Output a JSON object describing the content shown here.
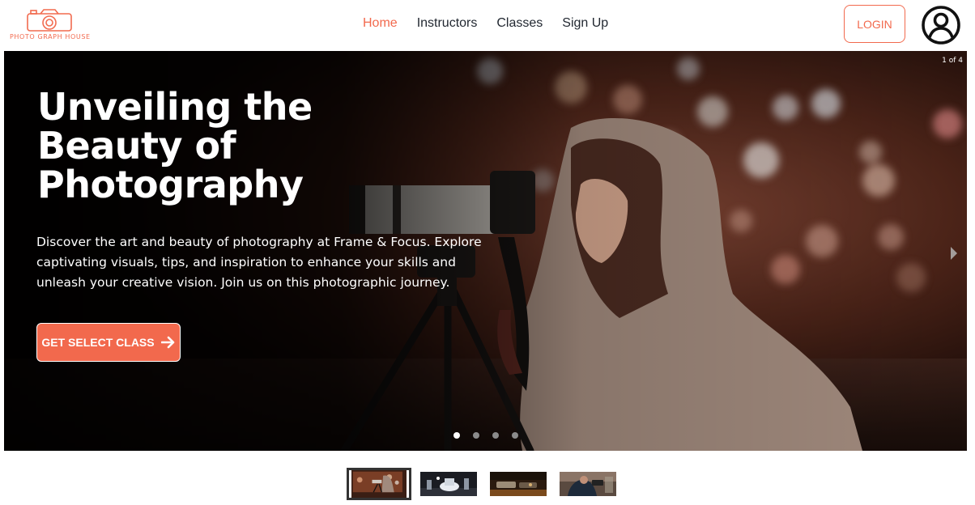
{
  "brand": {
    "name": "PHOTO GRAPH HOUSE",
    "accent": "#f2694d"
  },
  "nav": {
    "links": [
      {
        "label": "Home",
        "active": true
      },
      {
        "label": "Instructors",
        "active": false
      },
      {
        "label": "Classes",
        "active": false
      },
      {
        "label": "Sign Up",
        "active": false
      }
    ],
    "login_label": "LOGIN",
    "avatar_icon": "user-circle-icon"
  },
  "hero": {
    "title": "Unveiling the Beauty of Photography",
    "description": "Discover the art and beauty of photography at Frame & Focus. Explore captivating visuals, tips, and inspiration to enhance your skills and unleash your creative vision. Join us on this photographic journey.",
    "cta_label": "GET SELECT CLASS",
    "cta_icon": "arrow-right-icon",
    "counter": "1 of 4",
    "next_icon": "chevron-right-icon",
    "slides_total": 4,
    "current_slide": 1
  },
  "thumbnails": [
    {
      "label": "slide-1",
      "active": true
    },
    {
      "label": "slide-2",
      "active": false
    },
    {
      "label": "slide-3",
      "active": false
    },
    {
      "label": "slide-4",
      "active": false
    }
  ]
}
